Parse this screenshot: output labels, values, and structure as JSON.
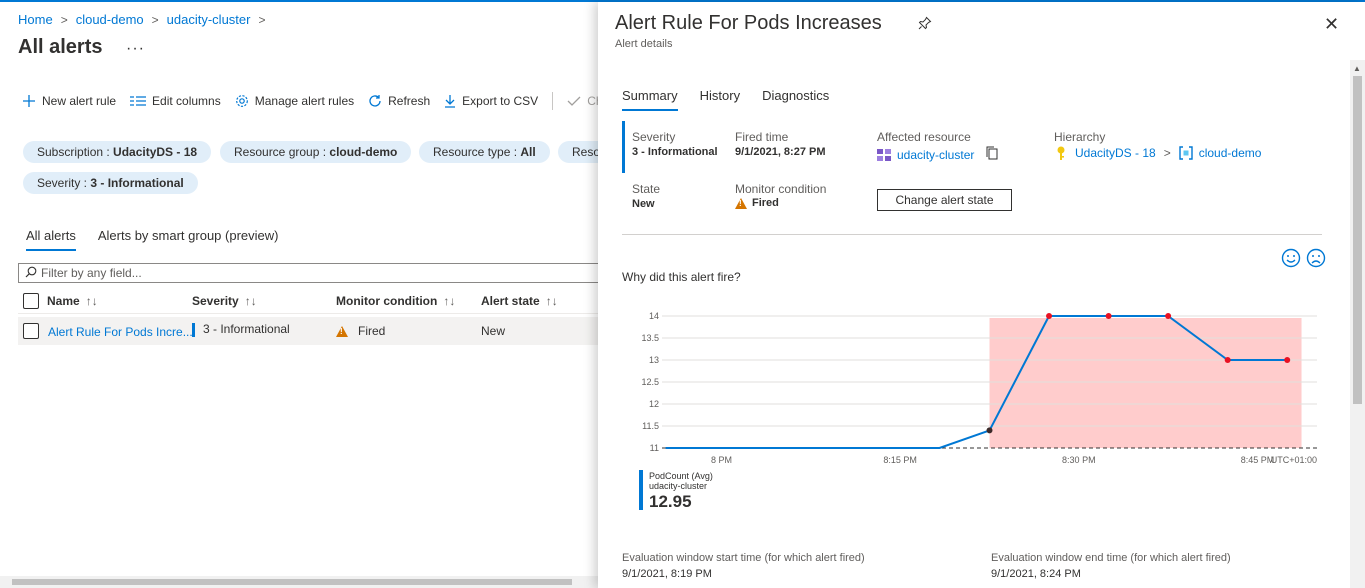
{
  "breadcrumb": [
    "Home",
    "cloud-demo",
    "udacity-cluster"
  ],
  "page": {
    "title": "All alerts",
    "more": "···"
  },
  "toolbar": {
    "new_alert_rule": "New alert rule",
    "edit_columns": "Edit columns",
    "manage_alert_rules": "Manage alert rules",
    "refresh": "Refresh",
    "export_csv": "Export to CSV",
    "change_state": "Ch"
  },
  "filters": {
    "subscription": {
      "label": "Subscription : ",
      "value": "UdacityDS - 18"
    },
    "resource_group": {
      "label": "Resource group : ",
      "value": "cloud-demo"
    },
    "resource_type": {
      "label": "Resource type : ",
      "value": "All"
    },
    "resource": {
      "label": "Reso",
      "value": ""
    },
    "severity": {
      "label": "Severity : ",
      "value": "3 - Informational"
    }
  },
  "left_tabs": {
    "all_alerts": "All alerts",
    "smart_group": "Alerts by smart group (preview)"
  },
  "filter_input": {
    "placeholder": "Filter by any field..."
  },
  "grid": {
    "columns": {
      "name": "Name",
      "severity": "Severity",
      "monitor": "Monitor condition",
      "state": "Alert state",
      "sort": "↑↓"
    },
    "row": {
      "name": "Alert Rule For Pods Incre...",
      "severity": "3 - Informational",
      "monitor": "Fired",
      "state": "New"
    }
  },
  "blade": {
    "title": "Alert Rule For Pods Increases",
    "subtitle": "Alert details",
    "close": "✕",
    "tabs": {
      "summary": "Summary",
      "history": "History",
      "diagnostics": "Diagnostics"
    },
    "fields": {
      "severity_label": "Severity",
      "severity_value": "3 - Informational",
      "fired_label": "Fired time",
      "fired_value": "9/1/2021, 8:27 PM",
      "resource_label": "Affected resource",
      "resource_value": "udacity-cluster",
      "hierarchy_label": "Hierarchy",
      "hierarchy_sub": "UdacityDS - 18",
      "hierarchy_rg": "cloud-demo",
      "state_label": "State",
      "state_value": "New",
      "monitor_label": "Monitor condition",
      "monitor_value": "Fired"
    },
    "change_state_button": "Change alert state",
    "why_fired": "Why did this alert fire?",
    "legend": {
      "series": "PodCount (Avg)",
      "resource": "udacity-cluster",
      "value": "12.95"
    },
    "eval": {
      "start_label": "Evaluation window start time (for which alert fired)",
      "start_value": "9/1/2021, 8:19 PM",
      "end_label": "Evaluation window end time (for which alert fired)",
      "end_value": "9/1/2021, 8:24 PM"
    }
  },
  "colors": {
    "accent": "#0078d4",
    "pill": "#e1eef9",
    "warn": "#d47500",
    "alert_region": "#ffcccc",
    "point": "#e81123"
  },
  "chart_data": {
    "type": "line",
    "x_axis": {
      "tick_labels": [
        "8 PM",
        "8:15 PM",
        "8:30 PM",
        "8:45 PM"
      ],
      "tick_minutes": [
        0,
        15,
        30,
        45
      ],
      "range_minutes": [
        -5,
        50
      ],
      "timezone_label": "UTC+01:00"
    },
    "y_axis": {
      "ticks": [
        "14",
        "13.5",
        "13",
        "12.5",
        "12",
        "11.5",
        "11"
      ],
      "range": [
        11,
        14
      ]
    },
    "series": [
      {
        "x_minutes": [
          -5,
          0,
          5,
          10,
          15,
          20,
          25,
          30,
          35,
          40,
          45
        ],
        "values": [
          11,
          11,
          11,
          11,
          11,
          11,
          11.4,
          14,
          14,
          14,
          13,
          13
        ],
        "marked_from_index": 6
      }
    ],
    "threshold": 11,
    "alert_window_minutes": [
      22.5,
      48.7
    ],
    "grid": true
  }
}
